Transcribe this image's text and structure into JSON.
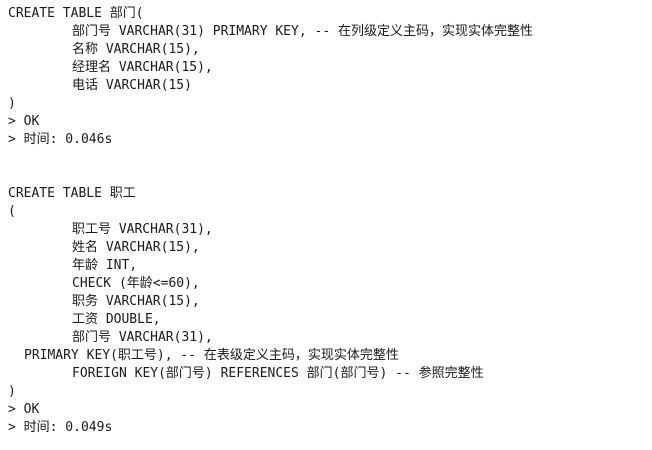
{
  "console": {
    "block1": {
      "l1": "CREATE TABLE 部门(",
      "l2": "部门号 VARCHAR(31) PRIMARY KEY, -- 在列级定义主码，实现实体完整性",
      "l3": "名称 VARCHAR(15),",
      "l4": "经理名 VARCHAR(15),",
      "l5": "电话 VARCHAR(15)",
      "l6": ")",
      "ok": "> OK",
      "time": "> 时间: 0.046s"
    },
    "block2": {
      "l1": "CREATE TABLE 职工",
      "l2": "(",
      "l3": "职工号 VARCHAR(31),",
      "l4": "姓名 VARCHAR(15),",
      "l5": "年龄 INT,",
      "l6": "CHECK (年龄<=60),",
      "l7": "职务 VARCHAR(15),",
      "l8": "工资 DOUBLE,",
      "l9": "部门号 VARCHAR(31),",
      "l10": "PRIMARY KEY(职工号), -- 在表级定义主码，实现实体完整性",
      "l11": "FOREIGN KEY(部门号) REFERENCES 部门(部门号) -- 参照完整性",
      "l12": ")",
      "ok": "> OK",
      "time": "> 时间: 0.049s"
    }
  }
}
